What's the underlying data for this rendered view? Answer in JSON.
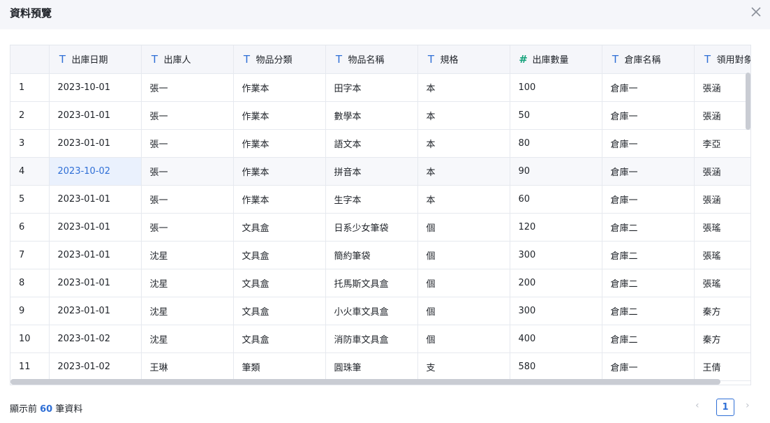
{
  "dialog": {
    "title": "資料預覽"
  },
  "icons": {
    "close": "close-icon",
    "text_type": "text-type-icon",
    "number_type": "number-type-icon",
    "prev": "chevron-left-icon",
    "next": "chevron-right-icon"
  },
  "colors": {
    "accent": "#2f6fd6",
    "number_icon": "#16a37c",
    "header_bg": "#f5f6fa"
  },
  "table": {
    "columns": [
      {
        "label": "出庫日期",
        "type": "text"
      },
      {
        "label": "出庫人",
        "type": "text"
      },
      {
        "label": "物品分類",
        "type": "text"
      },
      {
        "label": "物品名稱",
        "type": "text"
      },
      {
        "label": "規格",
        "type": "text"
      },
      {
        "label": "出庫數量",
        "type": "number"
      },
      {
        "label": "倉庫名稱",
        "type": "text"
      },
      {
        "label": "領用對象",
        "type": "text"
      }
    ],
    "rows": [
      {
        "index": "1",
        "cells": [
          "2023-10-01",
          "張一",
          "作業本",
          "田字本",
          "本",
          "100",
          "倉庫一",
          "張涵"
        ]
      },
      {
        "index": "2",
        "cells": [
          "2023-01-01",
          "張一",
          "作業本",
          "數學本",
          "本",
          "50",
          "倉庫一",
          "張涵"
        ]
      },
      {
        "index": "3",
        "cells": [
          "2023-01-01",
          "張一",
          "作業本",
          "語文本",
          "本",
          "80",
          "倉庫一",
          "李亞"
        ]
      },
      {
        "index": "4",
        "cells": [
          "2023-10-02",
          "張一",
          "作業本",
          "拼音本",
          "本",
          "90",
          "倉庫一",
          "張涵"
        ]
      },
      {
        "index": "5",
        "cells": [
          "2023-01-01",
          "張一",
          "作業本",
          "生字本",
          "本",
          "60",
          "倉庫一",
          "張涵"
        ]
      },
      {
        "index": "6",
        "cells": [
          "2023-01-01",
          "張一",
          "文具盒",
          "日系少女筆袋",
          "個",
          "120",
          "倉庫二",
          "張瑤"
        ]
      },
      {
        "index": "7",
        "cells": [
          "2023-01-01",
          "沈星",
          "文具盒",
          "簡約筆袋",
          "個",
          "300",
          "倉庫二",
          "張瑤"
        ]
      },
      {
        "index": "8",
        "cells": [
          "2023-01-01",
          "沈星",
          "文具盒",
          "托馬斯文具盒",
          "個",
          "200",
          "倉庫二",
          "張瑤"
        ]
      },
      {
        "index": "9",
        "cells": [
          "2023-01-01",
          "沈星",
          "文具盒",
          "小火車文具盒",
          "個",
          "300",
          "倉庫二",
          "秦方"
        ]
      },
      {
        "index": "10",
        "cells": [
          "2023-01-02",
          "沈星",
          "文具盒",
          "消防車文具盒",
          "個",
          "400",
          "倉庫二",
          "秦方"
        ]
      },
      {
        "index": "11",
        "cells": [
          "2023-01-02",
          "王琳",
          "筆類",
          "圓珠筆",
          "支",
          "580",
          "倉庫一",
          "王倩"
        ]
      }
    ]
  },
  "footer": {
    "prefix": "顯示前 ",
    "count": "60",
    "suffix": " 筆資料"
  },
  "pagination": {
    "current_page": "1",
    "prev_symbol": "‹",
    "next_symbol": "›"
  }
}
